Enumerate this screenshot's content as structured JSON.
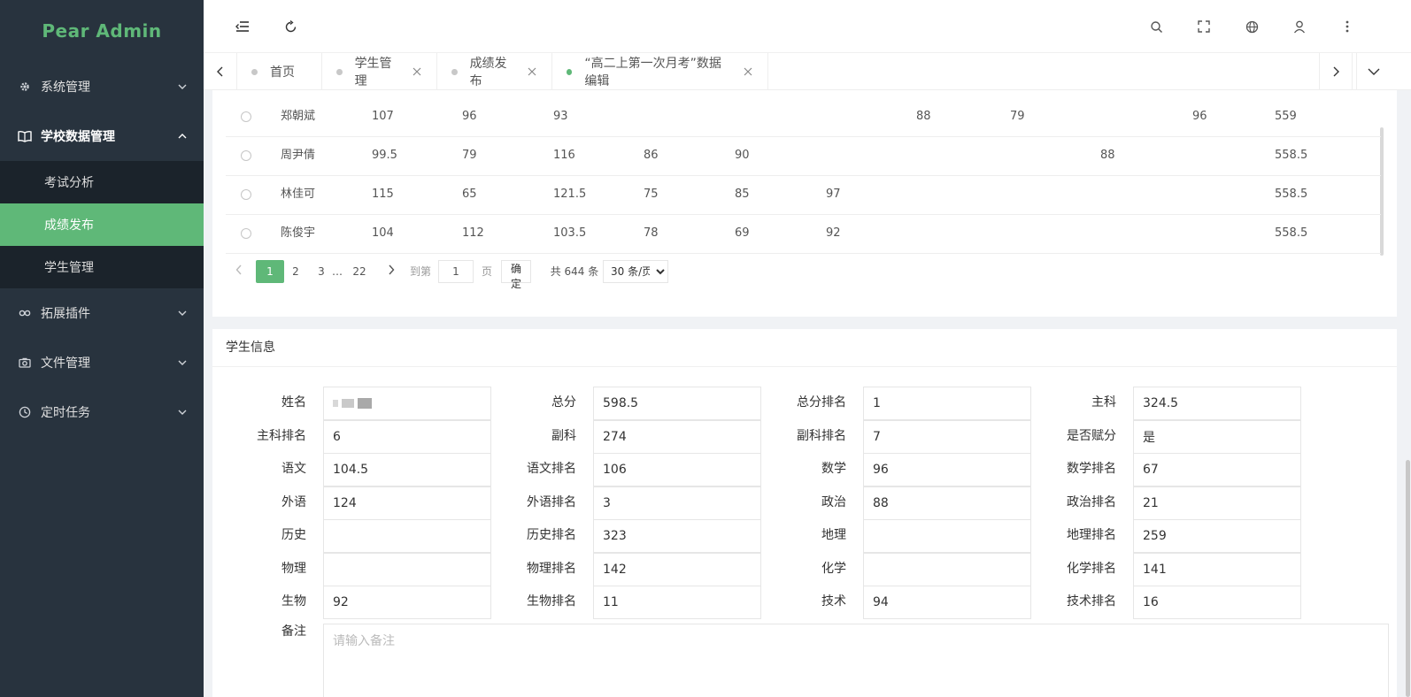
{
  "app": {
    "title": "Pear Admin"
  },
  "sidebar": {
    "menus": [
      {
        "label": "系统管理",
        "icon": "gear-icon"
      },
      {
        "label": "学校数据管理",
        "icon": "book-icon"
      },
      {
        "label": "拓展插件",
        "icon": "link-icon"
      },
      {
        "label": "文件管理",
        "icon": "camera-icon"
      },
      {
        "label": "定时任务",
        "icon": "clock-icon"
      }
    ],
    "submenu": [
      {
        "label": "考试分析"
      },
      {
        "label": "成绩发布"
      },
      {
        "label": "学生管理"
      }
    ]
  },
  "tabs": [
    {
      "label": "首页"
    },
    {
      "label": "学生管理"
    },
    {
      "label": "成绩发布"
    },
    {
      "label": "“高二上第一次月考”数据编辑"
    }
  ],
  "table": {
    "rows": [
      {
        "name": "郑朝斌",
        "cells": [
          "107",
          "96",
          "93",
          "",
          "",
          "",
          "88",
          "79",
          "",
          "96",
          "559"
        ]
      },
      {
        "name": "周尹倩",
        "cells": [
          "99.5",
          "79",
          "116",
          "86",
          "90",
          "",
          "",
          "",
          "88",
          "",
          "558.5"
        ]
      },
      {
        "name": "林佳可",
        "cells": [
          "115",
          "65",
          "121.5",
          "75",
          "85",
          "97",
          "",
          "",
          "",
          "",
          "558.5"
        ]
      },
      {
        "name": "陈俊宇",
        "cells": [
          "104",
          "112",
          "103.5",
          "78",
          "69",
          "92",
          "",
          "",
          "",
          "",
          "558.5"
        ]
      }
    ]
  },
  "pagination": {
    "pages": [
      "1",
      "2",
      "3",
      "…",
      "22"
    ],
    "goto_label": "到第",
    "goto_value": "1",
    "page_unit": "页",
    "confirm": "确定",
    "total": "共 644 条",
    "page_size": "30 条/页"
  },
  "info": {
    "title": "学生信息",
    "fields": [
      {
        "label": "姓名",
        "value": ""
      },
      {
        "label": "总分",
        "value": "598.5"
      },
      {
        "label": "总分排名",
        "value": "1"
      },
      {
        "label": "主科",
        "value": "324.5"
      },
      {
        "label": "主科排名",
        "value": "6"
      },
      {
        "label": "副科",
        "value": "274"
      },
      {
        "label": "副科排名",
        "value": "7"
      },
      {
        "label": "是否赋分",
        "value": "是"
      },
      {
        "label": "语文",
        "value": "104.5"
      },
      {
        "label": "语文排名",
        "value": "106"
      },
      {
        "label": "数学",
        "value": "96"
      },
      {
        "label": "数学排名",
        "value": "67"
      },
      {
        "label": "外语",
        "value": "124"
      },
      {
        "label": "外语排名",
        "value": "3"
      },
      {
        "label": "政治",
        "value": "88"
      },
      {
        "label": "政治排名",
        "value": "21"
      },
      {
        "label": "历史",
        "value": ""
      },
      {
        "label": "历史排名",
        "value": "323"
      },
      {
        "label": "地理",
        "value": ""
      },
      {
        "label": "地理排名",
        "value": "259"
      },
      {
        "label": "物理",
        "value": ""
      },
      {
        "label": "物理排名",
        "value": "142"
      },
      {
        "label": "化学",
        "value": ""
      },
      {
        "label": "化学排名",
        "value": "141"
      },
      {
        "label": "生物",
        "value": "92"
      },
      {
        "label": "生物排名",
        "value": "11"
      },
      {
        "label": "技术",
        "value": "94"
      },
      {
        "label": "技术排名",
        "value": "16"
      }
    ],
    "remark_label": "备注",
    "remark_placeholder": "请输入备注"
  },
  "colors": {
    "accent": "#5fb878",
    "sidebar": "#28333e",
    "submenu": "#1b232b"
  }
}
